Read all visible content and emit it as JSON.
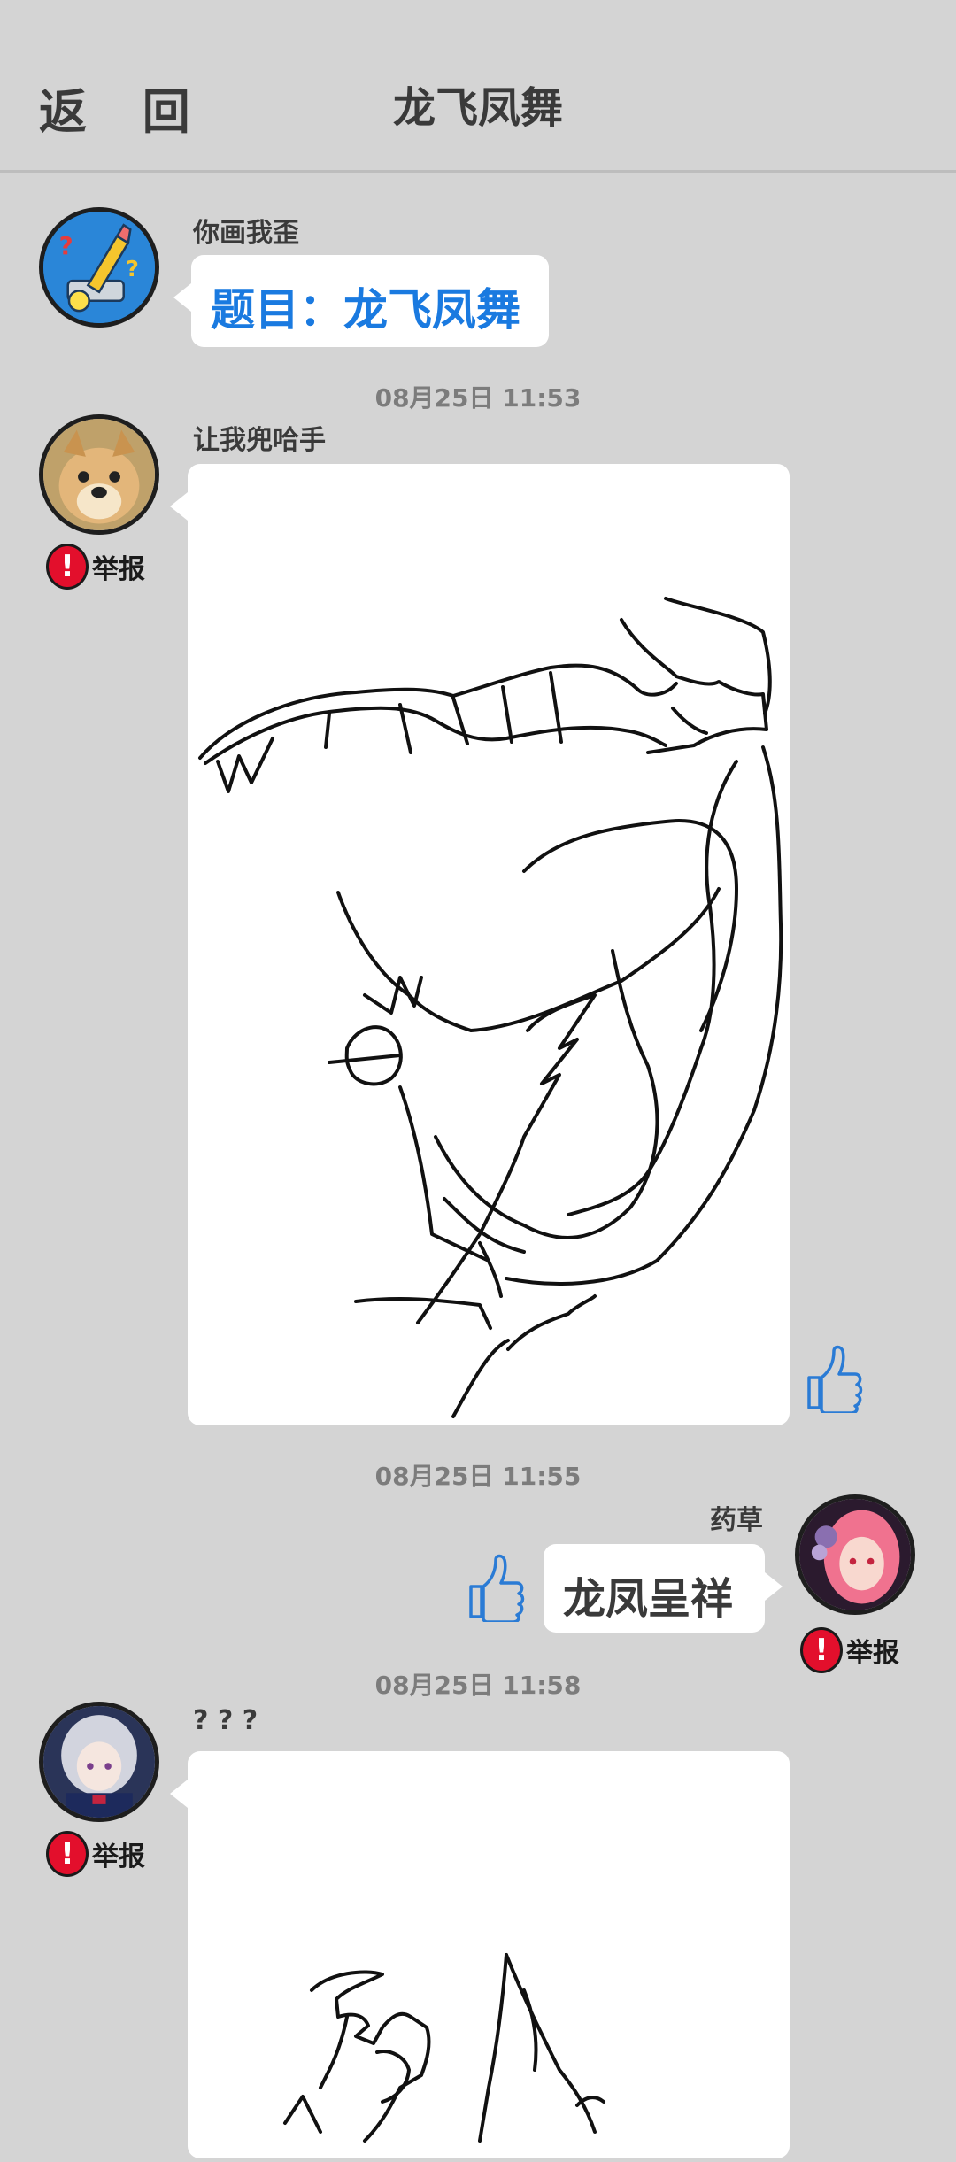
{
  "header": {
    "back_label": "返 回",
    "title": "龙飞凤舞"
  },
  "messages": [
    {
      "username": "你画我歪",
      "text": "题目：龙飞凤舞",
      "text_color": "#1a7ae0"
    },
    {
      "timestamp": "08月25日  11:53",
      "username": "让我兜哈手",
      "report_label": "举报"
    },
    {
      "timestamp": "08月25日  11:55",
      "username": "药草",
      "text": "龙凤呈祥",
      "report_label": "举报"
    },
    {
      "timestamp": "08月25日  11:58",
      "username": "? ? ?",
      "report_label": "举报"
    }
  ],
  "icons": {
    "like": "thumbs-up-icon",
    "report": "exclamation-icon",
    "report_color": "#e30f2c",
    "accent": "#1a7ae0"
  }
}
